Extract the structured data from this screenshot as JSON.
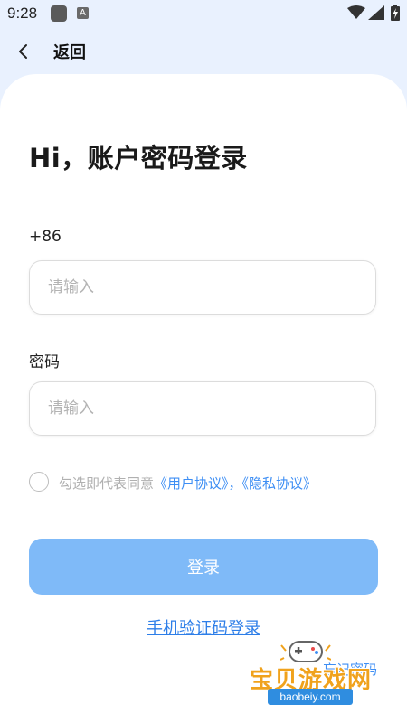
{
  "status_bar": {
    "time": "9:28",
    "app_badge": "A"
  },
  "header": {
    "back_label": "返回"
  },
  "login": {
    "title": "Hi，账户密码登录",
    "phone_label": "+86",
    "phone_placeholder": "请输入",
    "password_label": "密码",
    "password_placeholder": "请输入",
    "agree_prefix": "勾选即代表同意",
    "user_agreement": "《用户协议》",
    "separator": "，",
    "privacy_agreement": "《隐私协议》",
    "login_button": "登录",
    "sms_login": "手机验证码登录",
    "forgot_password": "忘记密码"
  },
  "watermark": {
    "text": "宝贝游戏网",
    "url": "baobeiy.com"
  },
  "colors": {
    "background": "#e9f1fe",
    "accent": "#3d8ef4",
    "button": "#7fbaf8"
  }
}
